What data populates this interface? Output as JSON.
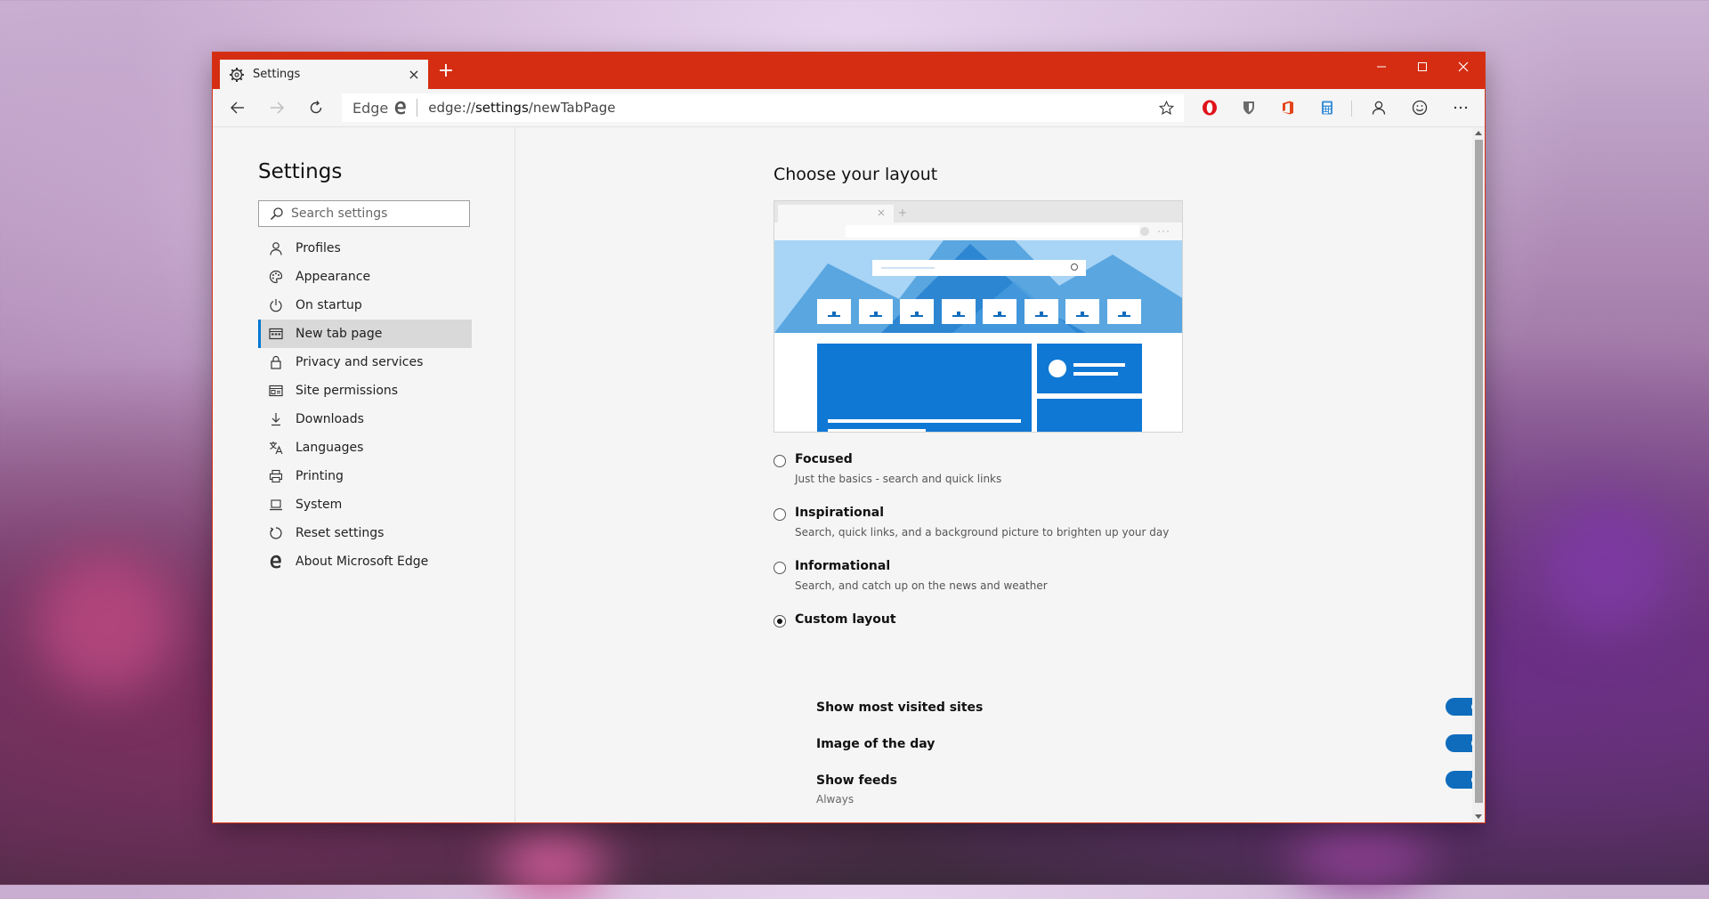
{
  "tab": {
    "title": "Settings",
    "close": "×",
    "new_tab": "+"
  },
  "address_bar": {
    "brand": "Edge",
    "url_prefix": "edge://",
    "url_path": "settings",
    "url_rest": "/newTabPage"
  },
  "sidebar": {
    "title": "Settings",
    "search_placeholder": "Search settings",
    "items": [
      {
        "label": "Profiles",
        "icon": "person-icon"
      },
      {
        "label": "Appearance",
        "icon": "palette-icon"
      },
      {
        "label": "On startup",
        "icon": "power-icon"
      },
      {
        "label": "New tab page",
        "icon": "new-tab-page-icon",
        "active": true
      },
      {
        "label": "Privacy and services",
        "icon": "lock-icon"
      },
      {
        "label": "Site permissions",
        "icon": "site-permissions-icon"
      },
      {
        "label": "Downloads",
        "icon": "download-icon"
      },
      {
        "label": "Languages",
        "icon": "languages-icon"
      },
      {
        "label": "Printing",
        "icon": "printer-icon"
      },
      {
        "label": "System",
        "icon": "laptop-icon"
      },
      {
        "label": "Reset settings",
        "icon": "reset-icon"
      },
      {
        "label": "About Microsoft Edge",
        "icon": "edge-logo-icon"
      }
    ]
  },
  "main": {
    "heading": "Choose your layout",
    "layouts": [
      {
        "label": "Focused",
        "desc": "Just the basics - search and quick links",
        "selected": false
      },
      {
        "label": "Inspirational",
        "desc": "Search, quick links, and a background picture to brighten up your day",
        "selected": false
      },
      {
        "label": "Informational",
        "desc": "Search, and catch up on the news and weather",
        "selected": false
      },
      {
        "label": "Custom layout",
        "desc": "",
        "selected": true
      }
    ],
    "custom_options": [
      {
        "label": "Show most visited sites",
        "sub": "",
        "on": true
      },
      {
        "label": "Image of the day",
        "sub": "",
        "on": true
      },
      {
        "label": "Show feeds",
        "sub": "Always",
        "on": true
      }
    ]
  },
  "colors": {
    "titlebar": "#d42d12",
    "accent": "#0078d4",
    "toggle_on": "#0f6cbd"
  }
}
